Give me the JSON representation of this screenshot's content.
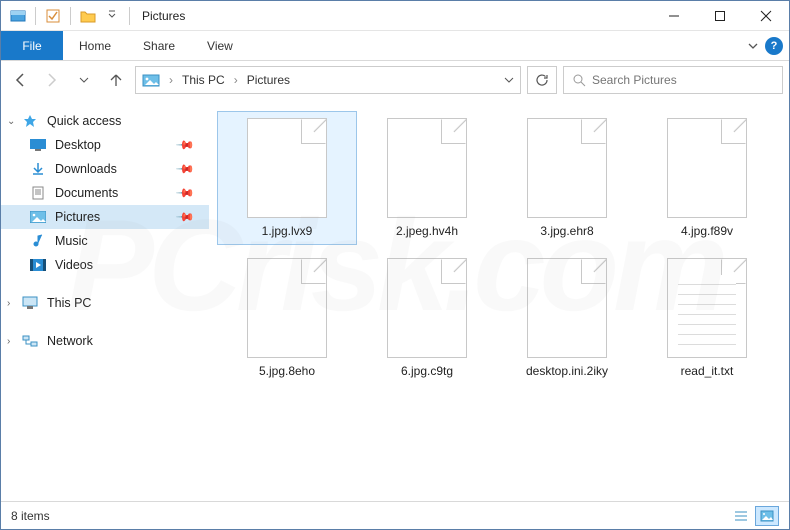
{
  "titlebar": {
    "title": "Pictures"
  },
  "ribbon": {
    "file": "File",
    "tabs": [
      "Home",
      "Share",
      "View"
    ]
  },
  "breadcrumb": {
    "parts": [
      "This PC",
      "Pictures"
    ]
  },
  "search": {
    "placeholder": "Search Pictures"
  },
  "sidebar": {
    "quick_access": "Quick access",
    "items": [
      {
        "label": "Desktop",
        "pinned": true
      },
      {
        "label": "Downloads",
        "pinned": true
      },
      {
        "label": "Documents",
        "pinned": true
      },
      {
        "label": "Pictures",
        "pinned": true,
        "selected": true
      },
      {
        "label": "Music",
        "pinned": false
      },
      {
        "label": "Videos",
        "pinned": false
      }
    ],
    "this_pc": "This PC",
    "network": "Network"
  },
  "files": [
    {
      "name": "1.jpg.lvx9",
      "type": "unknown",
      "selected": true
    },
    {
      "name": "2.jpeg.hv4h",
      "type": "unknown"
    },
    {
      "name": "3.jpg.ehr8",
      "type": "unknown"
    },
    {
      "name": "4.jpg.f89v",
      "type": "unknown"
    },
    {
      "name": "5.jpg.8eho",
      "type": "unknown"
    },
    {
      "name": "6.jpg.c9tg",
      "type": "unknown"
    },
    {
      "name": "desktop.ini.2iky",
      "type": "unknown"
    },
    {
      "name": "read_it.txt",
      "type": "txt"
    }
  ],
  "status": {
    "count": "8 items"
  }
}
